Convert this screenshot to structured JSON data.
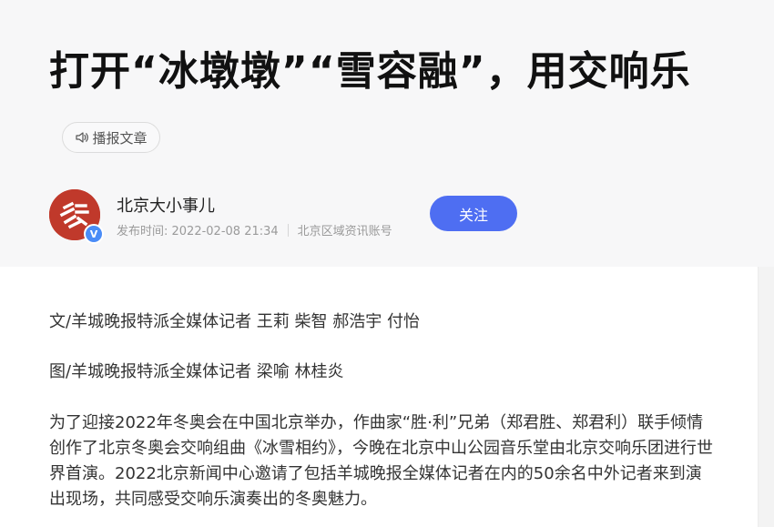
{
  "article": {
    "title": "打开“冰墩墩”“雪容融”，用交响乐",
    "listen_label": "播报文章",
    "author": {
      "name": "北京大小事儿",
      "verified_mark": "V",
      "publish_time": "发布时间: 2022-02-08 21:34",
      "account_type": "北京区域资讯账号"
    },
    "follow_label": "关注",
    "paragraphs": [
      "文/羊城晚报特派全媒体记者 王莉 柴智 郝浩宇 付怡",
      "图/羊城晚报特派全媒体记者 梁喻 林桂炎",
      "为了迎接2022年冬奥会在中国北京举办，作曲家“胜·利”兄弟（郑君胜、郑君利）联手倾情创作了北京冬奥会交响组曲《冰雪相约》，今晚在北京中山公园音乐堂由北京交响乐团进行世界首演。2022北京新闻中心邀请了包括羊城晚报全媒体记者在内的50余名中外记者来到演出现场，共同感受交响乐演奏出的冬奥魅力。"
    ]
  },
  "colors": {
    "header_bg": "#f7f7f8",
    "follow_button": "#4e6ef2",
    "avatar_bg": "#c0392b",
    "verified_badge": "#4a8cf7"
  },
  "icons": {
    "listen": "speaker-icon",
    "verified": "verified-badge-icon"
  }
}
